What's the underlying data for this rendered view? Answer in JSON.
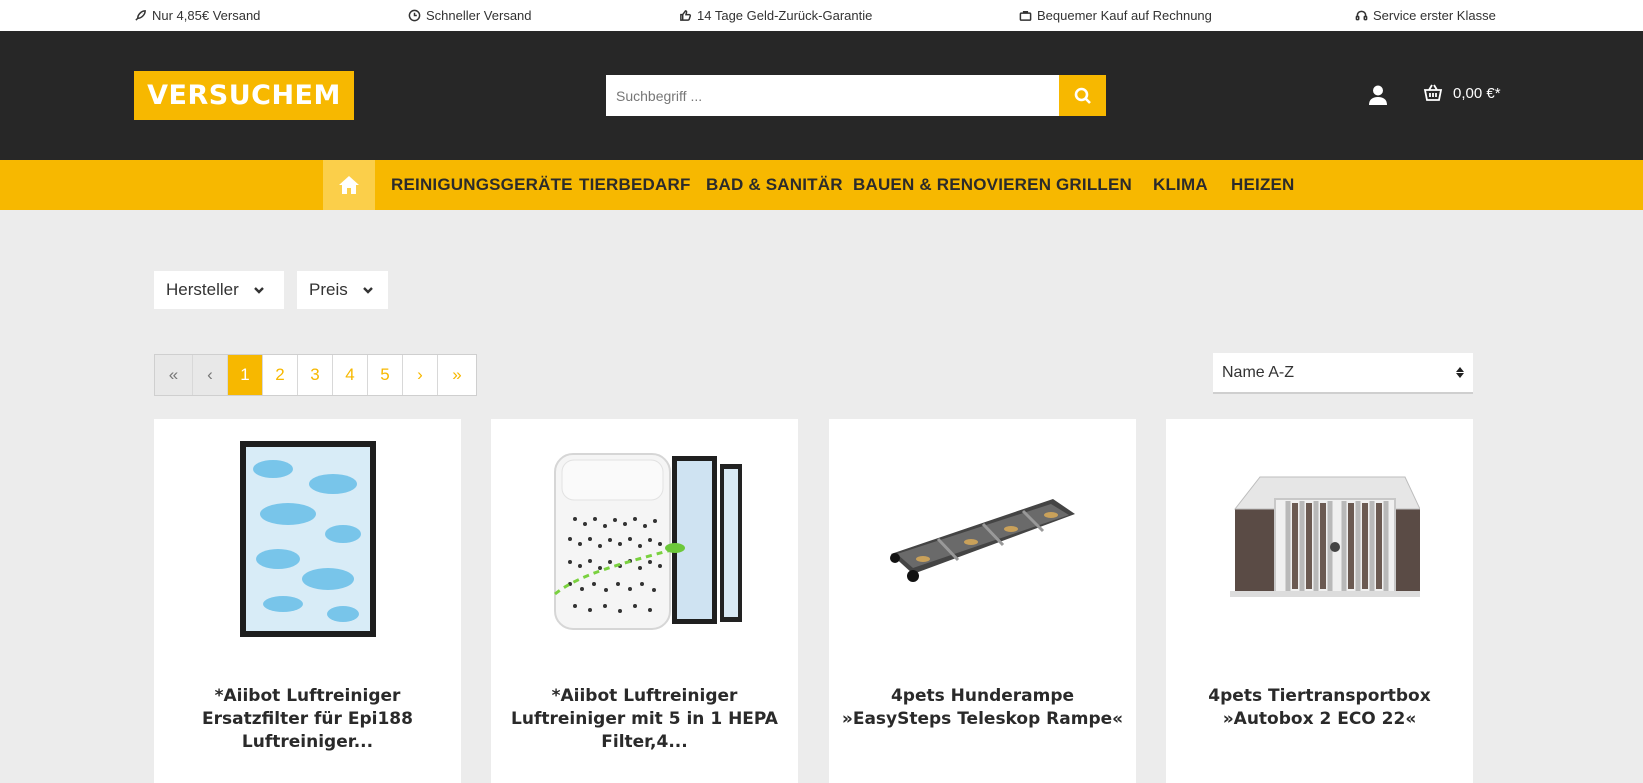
{
  "topbar": {
    "usps": [
      {
        "label": "Nur 4,85€ Versand",
        "icon": "rocket-icon"
      },
      {
        "label": "Schneller Versand",
        "icon": "clock-icon"
      },
      {
        "label": "14 Tage Geld-Zurück-Garantie",
        "icon": "thumbs-up-icon"
      },
      {
        "label": "Bequemer Kauf auf Rechnung",
        "icon": "briefcase-icon"
      },
      {
        "label": "Service erster Klasse",
        "icon": "headset-icon"
      }
    ]
  },
  "header": {
    "logo_text": "VERSUCHEM",
    "search_placeholder": "Suchbegriff ...",
    "cart_total": "0,00 €*"
  },
  "nav": {
    "items": [
      "REINIGUNGSGERÄTE",
      "TIERBEDARF",
      "BAD & SANITÄR",
      "BAUEN & RENOVIEREN",
      "GRILLEN",
      "KLIMA",
      "HEIZEN"
    ]
  },
  "filters": {
    "manufacturer": "Hersteller",
    "price": "Preis"
  },
  "pagination": {
    "first": "«",
    "prev": "‹",
    "pages": [
      "1",
      "2",
      "3",
      "4",
      "5"
    ],
    "current_page": "1",
    "next": "›",
    "last": "»"
  },
  "sort": {
    "selected": "Name A-Z"
  },
  "products": [
    {
      "title": "*Aiibot Luftreiniger Ersatzfilter für Epi188 Luftreiniger..."
    },
    {
      "title": "*Aiibot Luftreiniger Luftreiniger mit 5 in 1 HEPA Filter,4..."
    },
    {
      "title": "4pets Hunderampe »EasySteps Teleskop Rampe«"
    },
    {
      "title": "4pets Tiertransportbox »Autobox 2 ECO 22«"
    }
  ],
  "colors": {
    "accent": "#f7b800",
    "header_bg": "#272727",
    "page_bg": "#ececec"
  }
}
